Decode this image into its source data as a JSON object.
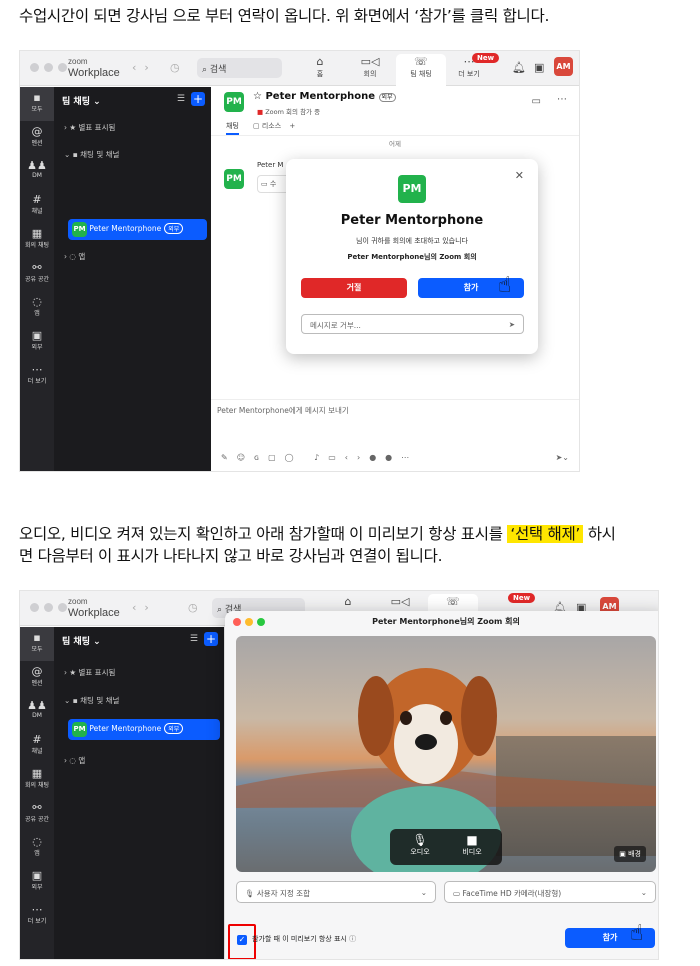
{
  "caption1": "수업시간이 되면 강사님 으로 부터 연락이 옵니다. 위 화면에서 ‘참가’를 클릭 합니다.",
  "caption2_pre": "오디오, 비디오 켜져 있는지 확인하고 아래 참가할때 이 미리보기 항상 표시를",
  "caption2_hl": "‘선택 해제’",
  "caption2_post": "하시",
  "caption2_line2": "면 다음부터 이 표시가 나타나지 않고 바로 강사님과 연결이 됩니다.",
  "app": {
    "logo_top": "zoom",
    "logo_bottom": "Workplace",
    "search": "검색",
    "tabs": [
      {
        "icon": "⌂",
        "label": "홈"
      },
      {
        "icon": "▭◁",
        "label": "회의"
      },
      {
        "icon": "☏",
        "label": "팀 채팅"
      },
      {
        "icon": "⋯",
        "label": "더 보기"
      }
    ],
    "new_badge": "New",
    "avatar": "AM"
  },
  "rail": [
    {
      "icon": "▪",
      "label": "모두"
    },
    {
      "icon": "@",
      "label": "멘션"
    },
    {
      "icon": "♟♟",
      "label": "DM"
    },
    {
      "icon": "#",
      "label": "채널"
    },
    {
      "icon": "▦",
      "label": "회의 채팅"
    },
    {
      "icon": "⚯",
      "label": "공유 공간"
    },
    {
      "icon": "◌",
      "label": "앱"
    },
    {
      "icon": "▣",
      "label": "외부"
    },
    {
      "icon": "⋯",
      "label": "더 보기"
    }
  ],
  "sidebar": {
    "title": "팀 채팅",
    "starred": "별표 표시됨",
    "channels": "채팅 및 채널",
    "contact": "Peter Mentorphone",
    "ext": "외부",
    "apps": "앱",
    "pm": "PM"
  },
  "chat": {
    "name": "Peter Mentorphone",
    "ext": "외부",
    "status": "Zoom 회의 참가 중",
    "tab_chat": "채팅",
    "tab_resources": "리소스",
    "date": "어제",
    "sender": "Peter M",
    "compose": "Peter Mentorphone에게 메시지 보내기"
  },
  "invite": {
    "name": "Peter Mentorphone",
    "line1": "님이 귀하를 회의에 초대하고 있습니다",
    "line2": "Peter Mentorphone님의 Zoom 회의",
    "decline": "거절",
    "join": "참가",
    "message_placeholder": "메시지로 거부..."
  },
  "preview": {
    "title": "Peter Mentorphone님의 Zoom 회의",
    "audio": "오디오",
    "video": "비디오",
    "bg": "배경",
    "mic": "사용자 지정 조합",
    "camera": "FaceTime HD 카메라(내장형)",
    "checkbox_label": "참가할 때 이 미리보기 항상 표시",
    "join": "참가"
  },
  "colors": {
    "blue": "#0b5cff",
    "red": "#e02828",
    "green": "#22b24c",
    "highlight": "#ffe600"
  }
}
